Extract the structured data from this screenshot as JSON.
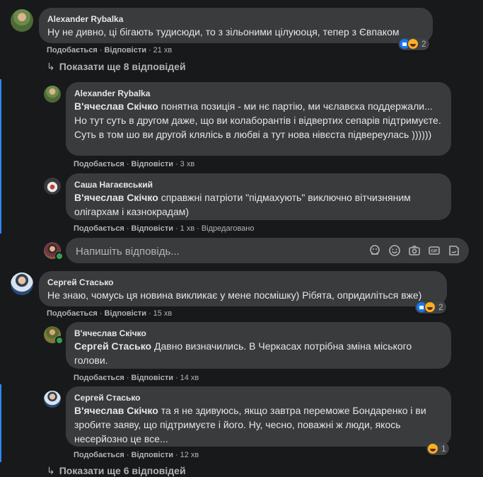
{
  "comments": [
    {
      "author": "Alexander Rybalka",
      "text": "Ну не дивно, ці бігають тудисюди, то з зільоними цілуюоця, тепер з Євпаком",
      "like": "Подобається",
      "reply": "Відповісти",
      "time": "21 хв",
      "reactions_count": "2"
    },
    {
      "author": "Сергей Стасько",
      "text": "Не знаю, чомусь ця новина викликає у мене посмішку) Рібята, опридиліться вже)",
      "like": "Подобається",
      "reply": "Відповісти",
      "time": "15 хв",
      "reactions_count": "2"
    }
  ],
  "more_replies_1": "Показати ще 8 відповідей",
  "more_replies_2": "Показати ще 6 відповідей",
  "replies_1": [
    {
      "author": "Alexander Rybalka",
      "mention": "В'ячеслав Скічко",
      "text": " понятна позиція - ми нє партію, ми чєлавєка поддержали... Но тут суть в другом даже, що ви колаборантів і відвертих сепарів підтримуєте. Суть в том шо ви другой клялісь в любві а тут нова нівєста підвереулась ))))))",
      "like": "Подобається",
      "reply": "Відповісти",
      "time": "3 хв"
    },
    {
      "author": "Саша Нагаєвський",
      "mention": "В'ячеслав Скічко",
      "text": " справжні патріоти \"підмахують\" виключно вітчизняним олігархам і казнокрадам)",
      "like": "Подобається",
      "reply": "Відповісти",
      "time": "1 хв",
      "edited": "Відредаговано"
    }
  ],
  "reply_box": {
    "placeholder": "Напишіть відповідь..."
  },
  "replies_2": [
    {
      "author": "В'ячеслав Скічко",
      "mention": "Сергей Стасько",
      "text": " Давно визначились. В Черкасах потрібна зміна міського голови.",
      "like": "Подобається",
      "reply": "Відповісти",
      "time": "14 хв"
    },
    {
      "author": "Сергей Стасько",
      "mention": "В'ячеслав Скічко",
      "text": " та я не здивуюсь, якщо завтра переможе Бондаренко і ви зробите заяву, що підтримуєте і його. Ну, чесно, поважні ж люди, якось несерйозно це все...",
      "like": "Подобається",
      "reply": "Відповісти",
      "time": "12 хв",
      "reactions_count": "1"
    }
  ],
  "colors": {
    "background": "#18191a",
    "bubble": "#3a3b3c",
    "thread_line": "#2d88ff",
    "secondary_text": "#b0b3b8"
  },
  "icons": [
    "sticker-icon",
    "emoji-icon",
    "camera-icon",
    "gif-icon",
    "sticker-alt-icon"
  ]
}
